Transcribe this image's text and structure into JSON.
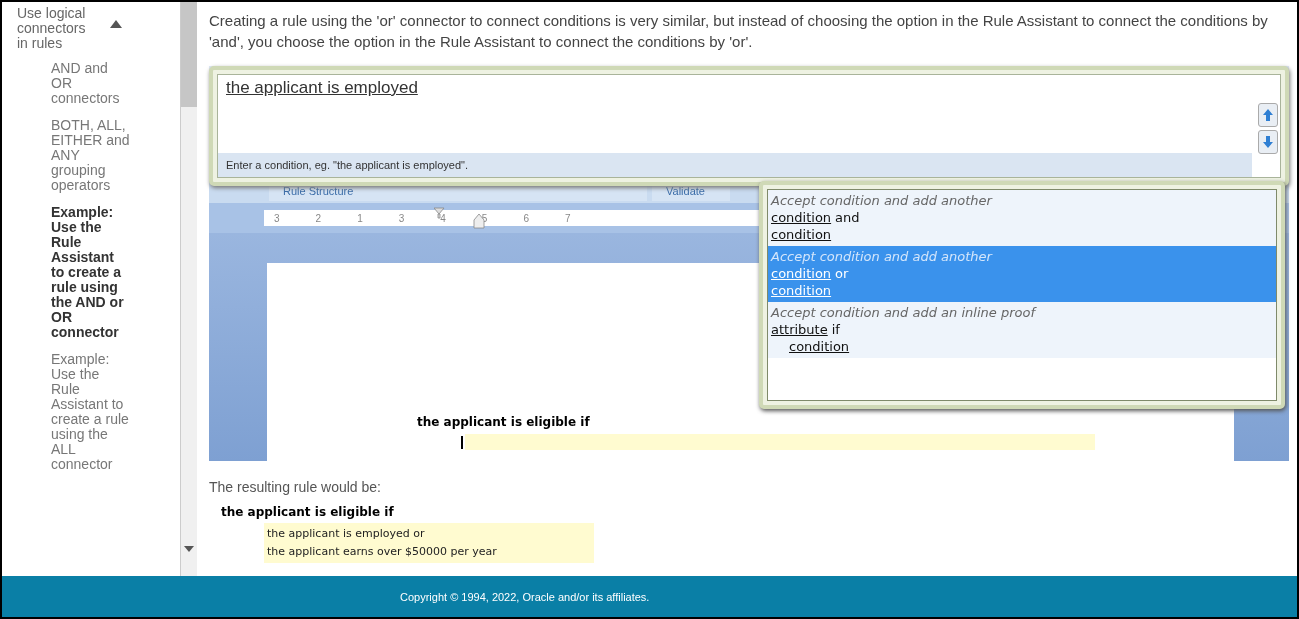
{
  "sidebar": {
    "items": [
      {
        "label": "Use logical connectors in rules",
        "expanded": true,
        "children": [
          {
            "label": "AND and OR connectors",
            "selected": false
          },
          {
            "label": "BOTH, ALL, EITHER and ANY grouping operators",
            "selected": false
          },
          {
            "label": "Example: Use the Rule Assistant to create a rule using the AND or OR connector",
            "selected": true
          },
          {
            "label": "Example: Use the Rule Assistant to create a rule using the ALL connector",
            "selected": false
          }
        ]
      }
    ]
  },
  "intro": "Creating a rule using the 'or' connector to connect conditions is very similar, but instead of choosing the option in the Rule Assistant to connect the conditions by 'and', you choose the option in the Rule Assistant to connect the conditions by 'or'.",
  "screenshot": {
    "condition_input": {
      "value": "the applicant is employed",
      "hint": "Enter a condition, eg. \"the applicant is employed\"."
    },
    "tabs": [
      {
        "label": "Rule Structure"
      },
      {
        "label": "Validate"
      }
    ],
    "ruler_labels": [
      "3",
      "2",
      "1",
      "3",
      "4",
      "5",
      "6",
      "7"
    ],
    "options": [
      {
        "description": "Accept condition and add another",
        "selected": false,
        "lines": [
          {
            "indented": false,
            "parts": [
              {
                "text": "condition",
                "underlined": true
              },
              {
                "text": "and",
                "underlined": false
              }
            ]
          },
          {
            "indented": false,
            "parts": [
              {
                "text": "condition",
                "underlined": true
              }
            ]
          }
        ]
      },
      {
        "description": "Accept condition and add another",
        "selected": true,
        "lines": [
          {
            "indented": false,
            "parts": [
              {
                "text": "condition",
                "underlined": true
              },
              {
                "text": "or",
                "underlined": false
              }
            ]
          },
          {
            "indented": false,
            "parts": [
              {
                "text": "condition",
                "underlined": true
              }
            ]
          }
        ]
      },
      {
        "description": "Accept condition and add an inline proof",
        "selected": false,
        "lines": [
          {
            "indented": false,
            "parts": [
              {
                "text": "attribute",
                "underlined": true
              },
              {
                "text": "if",
                "underlined": false
              }
            ]
          },
          {
            "indented": true,
            "parts": [
              {
                "text": "condition",
                "underlined": true
              }
            ]
          }
        ]
      }
    ],
    "document_heading": "the applicant is eligible if"
  },
  "result": {
    "caption": "The resulting rule would be:",
    "heading": "the applicant is eligible if",
    "lines": [
      "the applicant is employed or",
      "the applicant earns over $50000 per year"
    ]
  },
  "footer": "Copyright © 1994, 2022, Oracle and/or its affiliates."
}
